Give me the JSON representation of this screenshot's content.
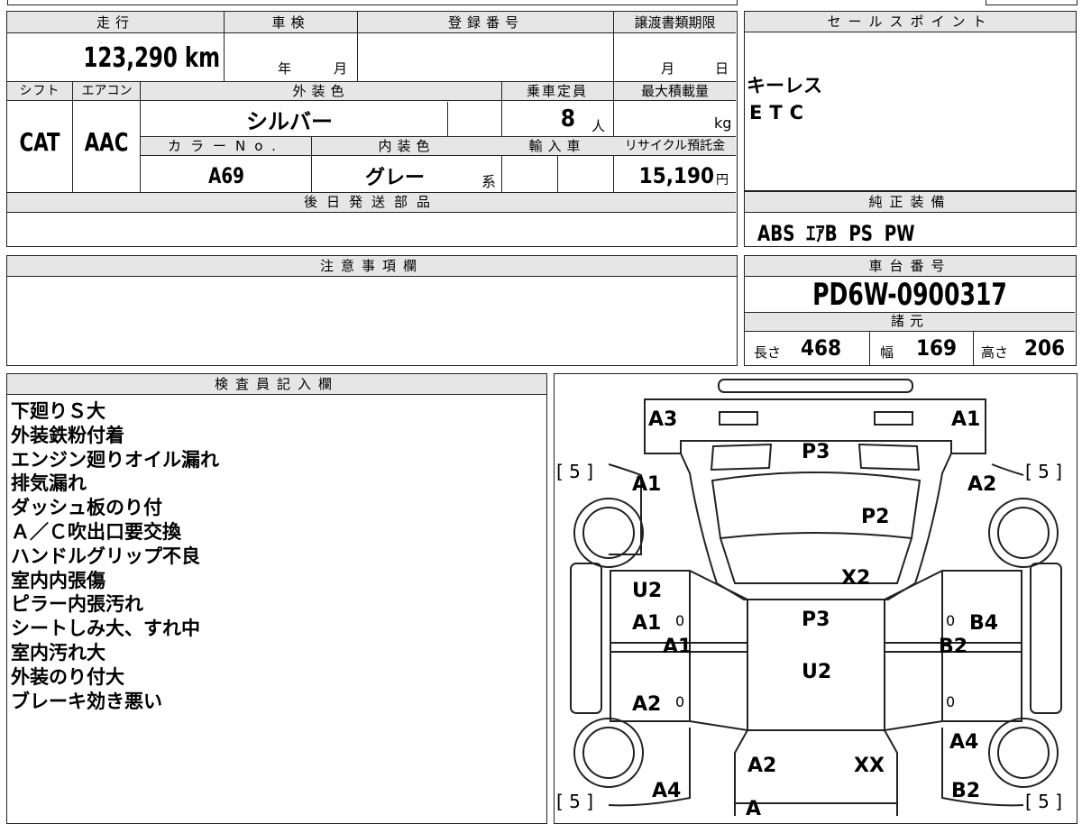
{
  "top_fields": {
    "mileage": {
      "label": "走行",
      "value": "123,290 km"
    },
    "inspection": {
      "label": "車検",
      "year_label": "年",
      "month_label": "月"
    },
    "registration": {
      "label": "登録番号",
      "value": ""
    },
    "transfer_deadline": {
      "label": "譲渡書類期限",
      "month_label": "月",
      "day_label": "日"
    },
    "shift": {
      "label": "シフト",
      "value": "CAT"
    },
    "aircon": {
      "label": "エアコン",
      "value": "AAC"
    },
    "exterior_color": {
      "label": "外装色",
      "value": "シルバー"
    },
    "capacity": {
      "label": "乗車定員",
      "value": "8",
      "unit": "人"
    },
    "max_load": {
      "label": "最大積載量",
      "value": "",
      "unit": "kg"
    },
    "color_no": {
      "label": "カラーNo.",
      "value": "A69"
    },
    "interior_color": {
      "label": "内装色",
      "value": "グレー",
      "suffix": "系"
    },
    "import": {
      "label": "輸入車",
      "value": ""
    },
    "recycle": {
      "label": "リサイクル預託金",
      "value": "15,190",
      "unit": "円"
    },
    "later_parts": {
      "label": "後日発送部品",
      "value": ""
    }
  },
  "sales_points": {
    "label": "セールスポイント",
    "items": [
      "キーレス",
      "ETC"
    ]
  },
  "genuine_equipment": {
    "label": "純正装備",
    "value": "ABS  ｴｱB  PS  PW"
  },
  "caution": {
    "label": "注意事項欄",
    "value": ""
  },
  "chassis": {
    "label": "車台番号",
    "value": "PD6W-0900317"
  },
  "specs": {
    "label": "諸元",
    "length": {
      "label": "長さ",
      "value": "468"
    },
    "width": {
      "label": "幅",
      "value": "169"
    },
    "height": {
      "label": "高さ",
      "value": "206"
    }
  },
  "inspector": {
    "label": "検査員記入欄",
    "lines": [
      "下廻りＳ大",
      "外装鉄粉付着",
      "エンジン廻りオイル漏れ",
      "排気漏れ",
      "ダッシュ板のり付",
      "Ａ／Ｃ吹出口要交換",
      "ハンドルグリップ不良",
      "室内内張傷",
      "ピラー内張汚れ",
      "シートしみ大、すれ中",
      "室内汚れ大",
      "外装のり付大",
      "ブレーキ効き悪い"
    ]
  },
  "diagram": {
    "tire_left_front": "[ 5 ]",
    "tire_right_front": "[ 5 ]",
    "tire_left_rear": "[ 5 ]",
    "tire_right_rear": "[ 5 ]",
    "marks": {
      "front_left_bumper": "A3",
      "front_right_bumper": "A1",
      "hood": "P3",
      "left_fender": "A1",
      "right_fender": "A2",
      "windshield": "P2",
      "cowl": "X2",
      "left_front_door_upper": "U2",
      "left_front_door": "A1",
      "left_front_door_zero": "0",
      "left_step": "A1",
      "left_rear_door": "A2",
      "left_rear_door_zero": "0",
      "roof": "P3",
      "roof2": "U2",
      "right_front_door": "B4",
      "right_front_door_zero": "0",
      "right_step": "B2",
      "right_rear_door_zero": "0",
      "right_quarter": "A4",
      "rear_glass_left": "A2",
      "rear_glass_right": "XX",
      "left_rear_quarter": "A4",
      "right_rear_bumper": "B2",
      "rear_bumper": "A"
    }
  }
}
